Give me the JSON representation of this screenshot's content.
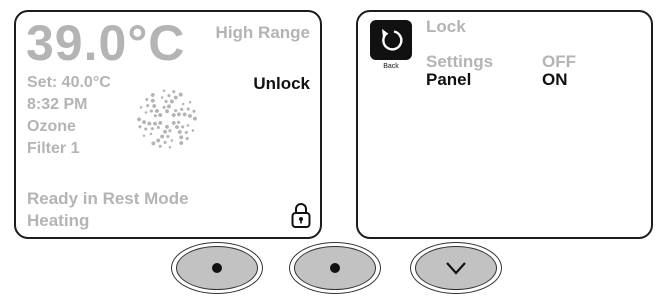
{
  "left_screen": {
    "temperature": "39.0°C",
    "range": "High Range",
    "set_point": "Set: 40.0°C",
    "time": "8:32 PM",
    "ozone": "Ozone",
    "filter": "Filter 1",
    "unlock": "Unlock",
    "mode": "Ready in Rest Mode",
    "heating": "Heating",
    "icons": {
      "pinwheel": "pinwheel-icon",
      "lock": "padlock-icon"
    }
  },
  "right_screen": {
    "back_label": "Back",
    "title": "Lock",
    "rows": [
      {
        "label": "Settings",
        "value": "OFF",
        "active": false
      },
      {
        "label": "Panel",
        "value": "ON",
        "active": true
      }
    ],
    "icons": {
      "back": "back-arrow-icon"
    }
  },
  "hardware_buttons": [
    {
      "name": "left-button",
      "icon": "dot-icon"
    },
    {
      "name": "middle-button",
      "icon": "dot-icon"
    },
    {
      "name": "down-button",
      "icon": "chevron-down-icon"
    }
  ],
  "colors": {
    "inactive_text": "#b4b4b4",
    "active_text": "#111111",
    "button_fill": "#c2c2c2"
  }
}
